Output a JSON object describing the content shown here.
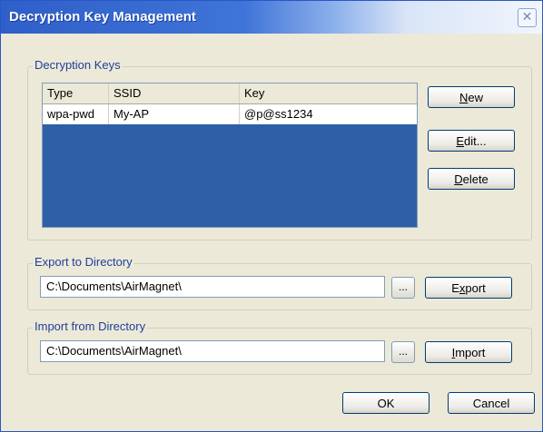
{
  "window": {
    "title": "Decryption Key Management",
    "close_glyph": "✕"
  },
  "keys_group": {
    "label": "Decryption Keys",
    "columns": [
      "Type",
      "SSID",
      "Key"
    ],
    "rows": [
      {
        "type": "wpa-pwd",
        "ssid": "My-AP",
        "key": "@p@ss1234"
      }
    ],
    "new_button": "New",
    "edit_button": "Edit...",
    "delete_button": "Delete"
  },
  "export_group": {
    "label": "Export to Directory",
    "path": "C:\\Documents\\AirMagnet\\",
    "browse_label": "...",
    "action_button": "Export"
  },
  "import_group": {
    "label": "Import from Directory",
    "path": "C:\\Documents\\AirMagnet\\",
    "browse_label": "...",
    "action_button": "Import"
  },
  "footer": {
    "ok_button": "OK",
    "cancel_button": "Cancel"
  },
  "colors": {
    "title_bar": "#2f5fc9",
    "group_label": "#1f3f9a",
    "list_background": "#2f5fa6"
  }
}
